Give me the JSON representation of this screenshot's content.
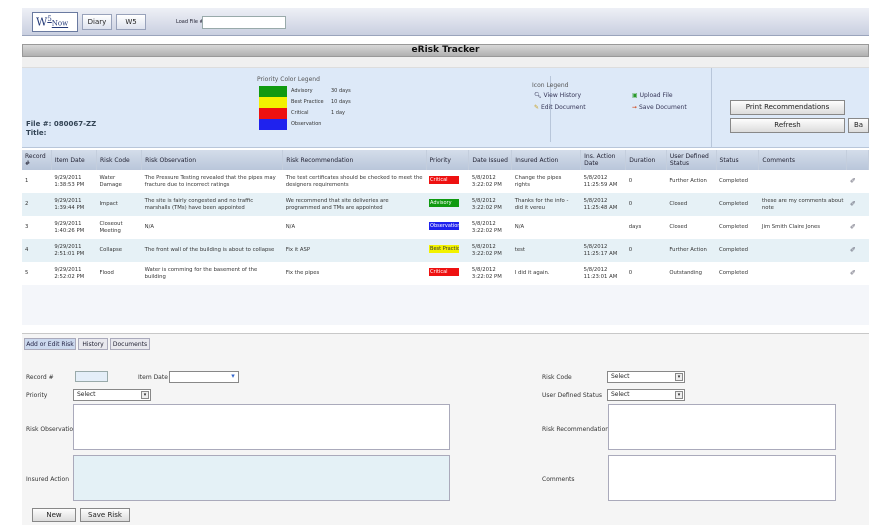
{
  "topbar": {
    "logo_main": "W",
    "logo_sup": "5",
    "logo_sub": "Now",
    "nav": [
      "Diary",
      "W5"
    ],
    "load_label": "Load File #:",
    "load_value": ""
  },
  "title": "eRisk Tracker",
  "file": {
    "label": "File #: 080067-ZZ",
    "title_label": "Title:"
  },
  "legend": {
    "title": "Priority Color Legend",
    "items": [
      {
        "name": "Advisory",
        "days": "30 days",
        "color": "#109a10"
      },
      {
        "name": "Best Practice",
        "days": "10 days",
        "color": "#f2f200"
      },
      {
        "name": "Critical",
        "days": "1 day",
        "color": "#ee1111"
      },
      {
        "name": "Observation",
        "days": "",
        "color": "#1f22ee"
      }
    ]
  },
  "icon_legend": {
    "title": "Icon Legend",
    "view_history": "View History",
    "edit_document": "Edit Document",
    "upload_file": "Upload File",
    "save_document": "Save Document"
  },
  "buttons": {
    "print": "Print Recommendations",
    "refresh": "Refresh",
    "back": "Ba"
  },
  "table": {
    "headers": [
      "Record #",
      "Item Date",
      "Risk Code",
      "Risk Observation",
      "Risk Recommendation",
      "Priority",
      "Date Issued",
      "Insured Action",
      "Ins. Action Date",
      "Duration",
      "User Defined Status",
      "Status",
      "Comments"
    ],
    "rows": [
      {
        "record": "1",
        "item_date": "9/29/2011 1:38:53 PM",
        "risk_code": "Water Damage",
        "observation": "The Pressure Testing revealed that the pipes may fracture due to incorrect ratings",
        "recommendation": "The test certificates should be checked to meet the designers requirements",
        "priority": "Critical",
        "priority_color": "#ee1111",
        "date_issued": "5/8/2012 3:22:02 PM",
        "insured_action": "Change the pipes rights",
        "action_date": "5/8/2012 11:25:59 AM",
        "duration": "0",
        "user_status": "Further Action",
        "status": "Completed",
        "comments": ""
      },
      {
        "record": "2",
        "item_date": "9/29/2011 1:39:44 PM",
        "risk_code": "Impact",
        "observation": "The site is fairly congested and no traffic marshalls (TMs) have been appointed",
        "recommendation": "We recommend that site deliveries are programmed and TMs are appointed",
        "priority": "Advisory",
        "priority_color": "#109a10",
        "date_issued": "5/8/2012 3:22:02 PM",
        "insured_action": "Thanks for the info - did it vereu",
        "action_date": "5/8/2012 11:25:48 AM",
        "duration": "0",
        "user_status": "Closed",
        "status": "Completed",
        "comments": "these are my comments about note"
      },
      {
        "record": "3",
        "item_date": "9/29/2011 1:40:26 PM",
        "risk_code": "Closeout Meeting",
        "observation": "N/A",
        "recommendation": "N/A",
        "priority": "Observation",
        "priority_color": "#1f22ee",
        "date_issued": "5/8/2012 3:22:02 PM",
        "insured_action": "N/A",
        "action_date": "",
        "duration": "days",
        "user_status": "Closed",
        "status": "Completed",
        "comments": "Jim Smith Claire Jones"
      },
      {
        "record": "4",
        "item_date": "9/29/2011 2:51:01 PM",
        "risk_code": "Collapse",
        "observation": "The front wall of the building is about to collapse",
        "recommendation": "Fix it ASP",
        "priority": "Best Practice",
        "priority_color": "#f2f200",
        "date_issued": "5/8/2012 3:22:02 PM",
        "insured_action": "test",
        "action_date": "5/8/2012 11:25:17 AM",
        "duration": "0",
        "user_status": "Further Action",
        "status": "Completed",
        "comments": ""
      },
      {
        "record": "5",
        "item_date": "9/29/2011 2:52:02 PM",
        "risk_code": "Flood",
        "observation": "Water is comming for the basement of the building",
        "recommendation": "Fix the pipes",
        "priority": "Critical",
        "priority_color": "#ee1111",
        "date_issued": "5/8/2012 3:22:02 PM",
        "insured_action": "I did it again.",
        "action_date": "5/8/2012 11:23:01 AM",
        "duration": "0",
        "user_status": "Outstanding",
        "status": "Completed",
        "comments": ""
      }
    ]
  },
  "form": {
    "tabs": [
      "Add or Edit Risk",
      "History",
      "Documents"
    ],
    "record_label": "Record #",
    "item_date_label": "Item Date",
    "priority_label": "Priority",
    "priority_value": "Select",
    "risk_observation_label": "Risk Observation",
    "insured_action_label": "Insured Action",
    "risk_code_label": "Risk Code",
    "risk_code_value": "Select",
    "user_status_label": "User Defined Status",
    "user_status_value": "Select",
    "risk_recommendation_label": "Risk Recommendation",
    "comments_label": "Comments",
    "new_button": "New",
    "save_button": "Save Risk"
  }
}
